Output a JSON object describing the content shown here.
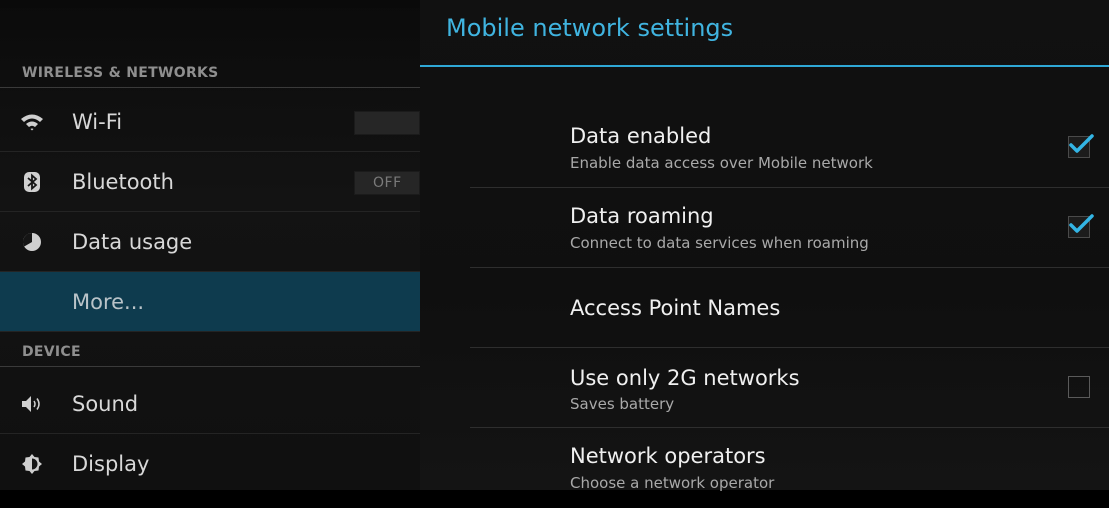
{
  "sidebar": {
    "sections": [
      {
        "label": "WIRELESS & NETWORKS"
      },
      {
        "label": "DEVICE"
      }
    ],
    "items": [
      {
        "label": "Wi-Fi",
        "icon": "wifi-icon"
      },
      {
        "label": "Bluetooth",
        "icon": "bluetooth-icon",
        "toggle": "OFF"
      },
      {
        "label": "Data usage",
        "icon": "data-usage-icon"
      },
      {
        "label": "More...",
        "selected": true
      },
      {
        "label": "Sound",
        "icon": "speaker-icon"
      },
      {
        "label": "Display",
        "icon": "brightness-icon"
      }
    ]
  },
  "panel": {
    "title": "Mobile network settings",
    "accent_color": "#33b5e5",
    "prefs": [
      {
        "title": "Data enabled",
        "summary": "Enable data access over Mobile network",
        "checked": true
      },
      {
        "title": "Data roaming",
        "summary": "Connect to data services when roaming",
        "checked": true
      },
      {
        "title": "Access Point Names"
      },
      {
        "title": "Use only 2G networks",
        "summary": "Saves battery",
        "checked": false
      },
      {
        "title": "Network operators",
        "summary": "Choose a network operator"
      }
    ]
  }
}
